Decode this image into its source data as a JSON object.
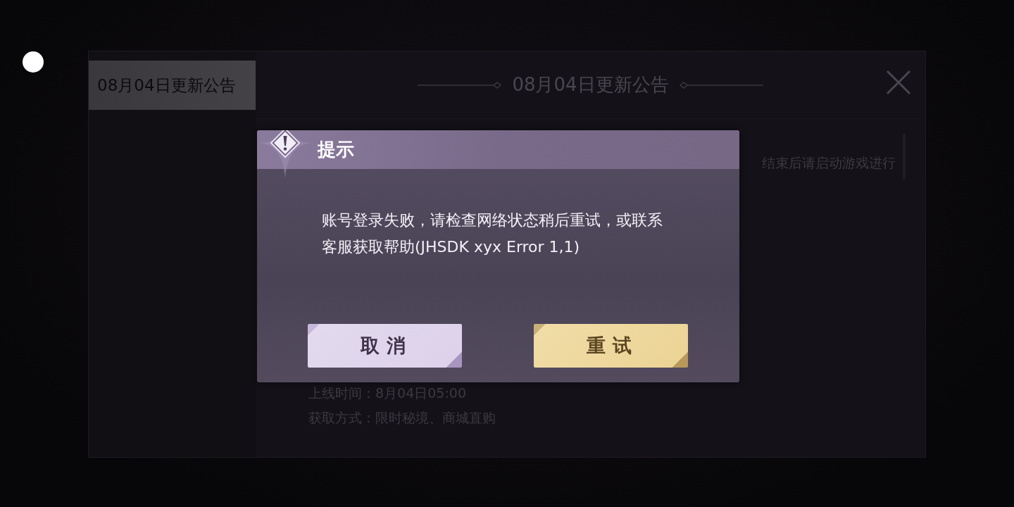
{
  "announcement": {
    "tabs": [
      {
        "label": "08月04日更新公告",
        "selected": true
      }
    ],
    "title": "08月04日更新公告",
    "body": [
      {
        "kind": "clipped",
        "text": "结束后请启动游戏进行"
      },
      {
        "kind": "line",
        "text": "上线时间：8月04日05:00"
      },
      {
        "kind": "line",
        "text": "获取方式：限时秘境、商城直购"
      }
    ]
  },
  "dialog": {
    "title": "提示",
    "message": "账号登录失败，请检查网络状态稍后重试，或联系客服获取帮助(JHSDK xyx Error 1,1)",
    "buttons": [
      {
        "label": "取消",
        "kind": "secondary"
      },
      {
        "label": "重试",
        "kind": "primary"
      }
    ]
  }
}
